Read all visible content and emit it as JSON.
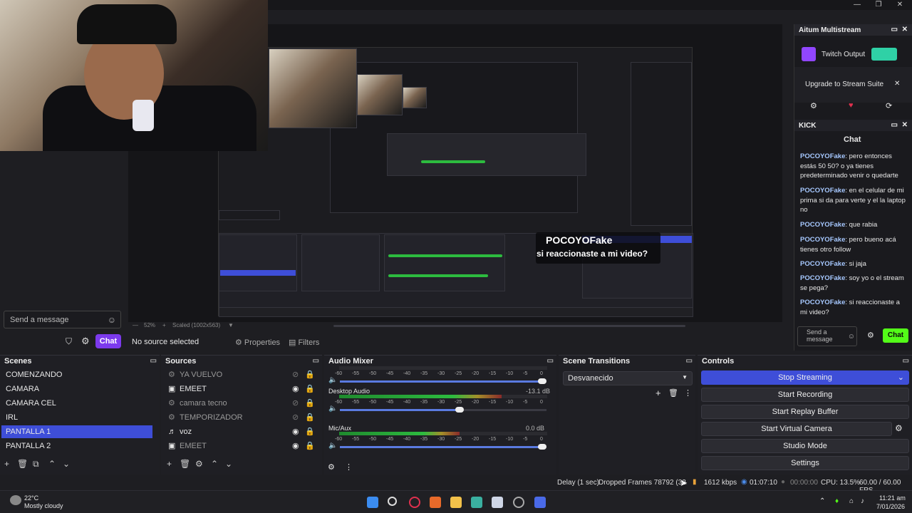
{
  "preview": {
    "caption_user": "POCOYOFake",
    "caption_message": "si reaccionaste a mi video?",
    "send_placeholder": "Send a message",
    "chat_button": "Chat",
    "zoom": "52%",
    "scaled": "Scaled (1002x563)",
    "no_source": "No source selected",
    "properties": "Properties",
    "filters": "Filters"
  },
  "multistream": {
    "title": "Aitum Multistream",
    "output": "Twitch Output",
    "upgrade": "Upgrade to Stream Suite"
  },
  "kick": {
    "title": "KICK",
    "chat_title": "Chat",
    "messages": [
      {
        "user": "POCOYOFake",
        "text": "pero entonces estás 50 50? o ya tienes predeterminado venir o quedarte"
      },
      {
        "user": "POCOYOFake",
        "text": "en el celular de mi prima si da para verte y el la laptop no"
      },
      {
        "user": "POCOYOFake",
        "text": "que rabia"
      },
      {
        "user": "POCOYOFake",
        "text": "pero bueno acá tienes otro follow"
      },
      {
        "user": "POCOYOFake",
        "text": "si jaja"
      },
      {
        "user": "POCOYOFake",
        "text": "soy yo o el stream se pega?"
      },
      {
        "user": "POCOYOFake",
        "text": "si reaccionaste a mi video?"
      }
    ],
    "send_placeholder": "Send a message",
    "chat_button": "Chat"
  },
  "scenes": {
    "title": "Scenes",
    "items": [
      "COMENZANDO",
      "CAMARA",
      "CAMARA CEL",
      "IRL",
      "PANTALLA 1",
      "PANTALLA 2"
    ],
    "selected": "PANTALLA 1"
  },
  "sources": {
    "title": "Sources",
    "items": [
      {
        "name": "YA VUELVO",
        "visible": false
      },
      {
        "name": "EMEET",
        "visible": true
      },
      {
        "name": "camara tecno",
        "visible": false
      },
      {
        "name": "TEMPORIZADOR",
        "visible": false
      },
      {
        "name": "voz",
        "visible": true
      },
      {
        "name": "EMEET",
        "visible": true
      }
    ]
  },
  "audio": {
    "title": "Audio Mixer",
    "scale": [
      "-60",
      "-55",
      "-50",
      "-45",
      "-40",
      "-35",
      "-30",
      "-25",
      "-20",
      "-15",
      "-10",
      "-5",
      "0"
    ],
    "channels": [
      {
        "name": "",
        "db": "",
        "level": 0.0,
        "volume": 0.98
      },
      {
        "name": "Desktop Audio",
        "db": "-13.1 dB",
        "level": 0.78,
        "volume": 0.58
      },
      {
        "name": "Mic/Aux",
        "db": "0.0 dB",
        "level": 0.58,
        "volume": 0.98
      }
    ]
  },
  "transitions": {
    "title": "Scene Transitions",
    "selected": "Desvanecido"
  },
  "controls": {
    "title": "Controls",
    "buttons": [
      "Stop Streaming",
      "Start Recording",
      "Start Replay Buffer",
      "Start Virtual Camera",
      "Studio Mode",
      "Settings"
    ]
  },
  "status": {
    "delay": "Delay (1 sec)",
    "dropped": "Dropped Frames 78792 (32.6%)",
    "bitrate": "1612 kbps",
    "stream_time": "01:07:10",
    "rec_time": "00:00:00",
    "cpu": "CPU: 13.5%",
    "fps": "60.00 / 60.00 FPS"
  },
  "taskbar": {
    "temp": "22°C",
    "weather": "Mostly cloudy",
    "time": "11:21 am",
    "date": "7/01/2026"
  },
  "colors": {
    "accent": "#3e4ed8",
    "kick_green": "#53fc18",
    "purple": "#7c3aed",
    "twitch": "#9146ff"
  }
}
